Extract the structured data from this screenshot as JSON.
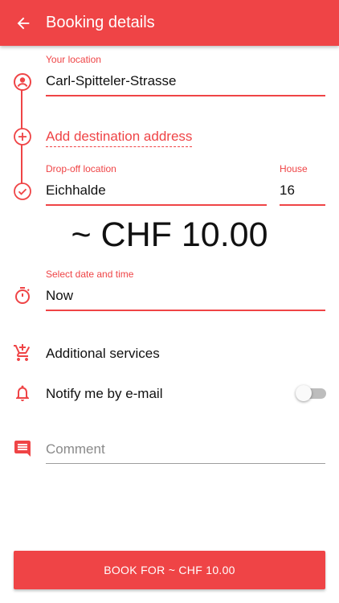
{
  "header": {
    "title": "Booking details"
  },
  "location": {
    "label": "Your location",
    "value": "Carl-Spitteler-Strasse"
  },
  "add_destination": {
    "label": "Add destination address"
  },
  "dropoff": {
    "label": "Drop-off location",
    "value": "Eichhalde"
  },
  "house": {
    "label": "House",
    "value": "16"
  },
  "price": {
    "text": "~ CHF 10.00"
  },
  "datetime": {
    "label": "Select date and time",
    "value": "Now"
  },
  "services": {
    "label": "Additional services"
  },
  "notify": {
    "label": "Notify me by e-mail",
    "enabled": false
  },
  "comment": {
    "placeholder": "Comment"
  },
  "book_button": {
    "label": "BOOK FOR ~ CHF 10.00"
  },
  "colors": {
    "accent": "#ef4446",
    "text": "#111111",
    "hint": "#8a8a8a"
  },
  "icons": [
    "back-arrow-icon",
    "person-circle-icon",
    "plus-circle-icon",
    "check-circle-icon",
    "timer-icon",
    "add-cart-icon",
    "bell-icon",
    "comment-icon"
  ]
}
